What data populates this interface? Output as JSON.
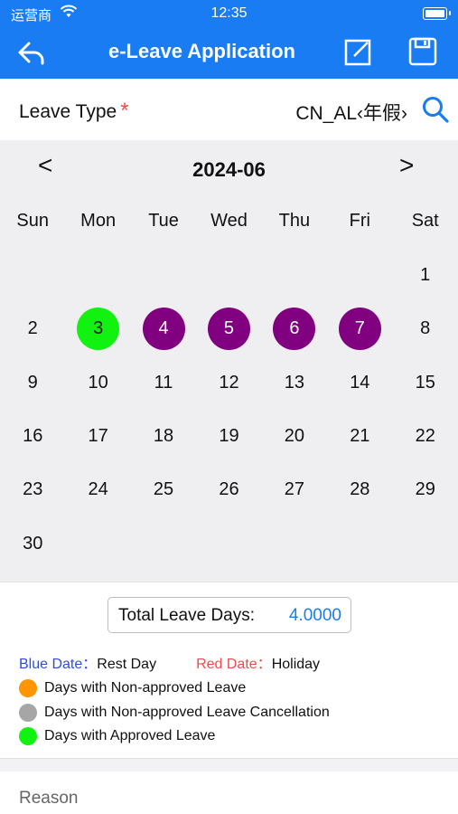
{
  "status_bar": {
    "carrier": "运营商",
    "time": "12:35"
  },
  "nav": {
    "title": "e-Leave Application",
    "icons": [
      "back-icon",
      "edit-icon",
      "save-icon"
    ]
  },
  "leave_type": {
    "label": "Leave Type",
    "required_mark": "*",
    "value": "CN_AL‹年假›"
  },
  "calendar": {
    "month": "2024-06",
    "prev": "<",
    "next": ">",
    "weekdays": [
      "Sun",
      "Mon",
      "Tue",
      "Wed",
      "Thu",
      "Fri",
      "Sat"
    ],
    "leading_blanks": 6,
    "days": [
      {
        "d": "1"
      },
      {
        "d": "2"
      },
      {
        "d": "3",
        "state": "approved"
      },
      {
        "d": "4",
        "state": "selected"
      },
      {
        "d": "5",
        "state": "selected"
      },
      {
        "d": "6",
        "state": "selected"
      },
      {
        "d": "7",
        "state": "selected"
      },
      {
        "d": "8"
      },
      {
        "d": "9"
      },
      {
        "d": "10"
      },
      {
        "d": "11"
      },
      {
        "d": "12"
      },
      {
        "d": "13"
      },
      {
        "d": "14"
      },
      {
        "d": "15"
      },
      {
        "d": "16"
      },
      {
        "d": "17"
      },
      {
        "d": "18"
      },
      {
        "d": "19"
      },
      {
        "d": "20"
      },
      {
        "d": "21"
      },
      {
        "d": "22"
      },
      {
        "d": "23"
      },
      {
        "d": "24"
      },
      {
        "d": "25"
      },
      {
        "d": "26"
      },
      {
        "d": "27"
      },
      {
        "d": "28"
      },
      {
        "d": "29"
      },
      {
        "d": "30"
      }
    ]
  },
  "summary": {
    "total_label": "Total Leave Days:",
    "total_value": "4.0000",
    "blue_date_label": "Blue Date：",
    "blue_date_value": "Rest Day",
    "red_date_label": "Red Date：",
    "red_date_value": "Holiday",
    "legend": [
      {
        "label": "Days with Non-approved Leave",
        "color": "#ff9500"
      },
      {
        "label": "Days with Non-approved Leave Cancellation",
        "color": "#a6a6a6"
      },
      {
        "label": "Days with Approved Leave",
        "color": "#11f211"
      }
    ]
  },
  "reason": {
    "label": "Reason"
  },
  "colors": {
    "primary": "#1a7cf2",
    "selected": "#800080",
    "approved": "#11f211",
    "required": "#ef4b4b"
  }
}
